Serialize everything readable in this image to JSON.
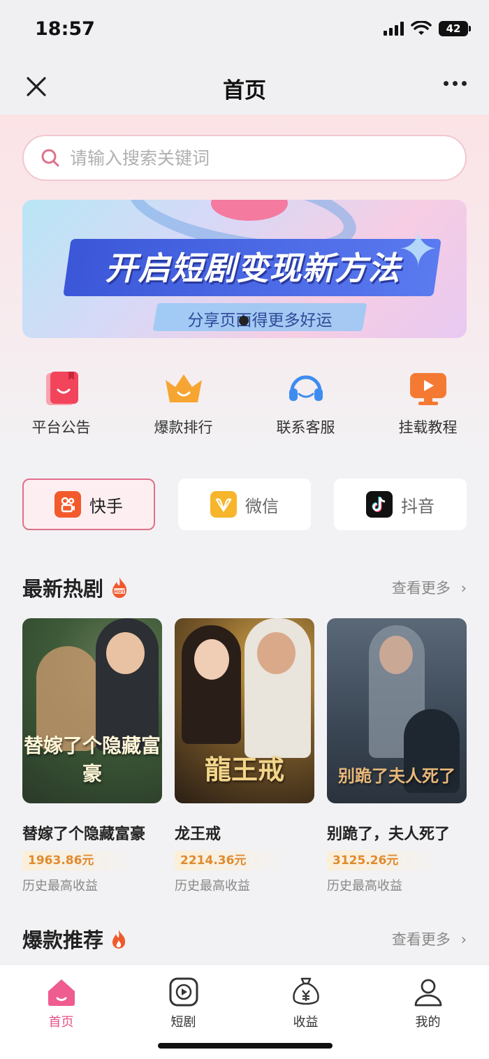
{
  "status": {
    "time": "18:57",
    "battery": "42"
  },
  "nav": {
    "title": "首页"
  },
  "search": {
    "placeholder": "请输入搜索关键词"
  },
  "banner": {
    "title": "开启短剧变现新方法",
    "subtitle": "分享页面得更多好运"
  },
  "quick_menu": [
    {
      "label": "平台公告",
      "icon": "bookmark-icon",
      "color": "#f2455c"
    },
    {
      "label": "爆款排行",
      "icon": "crown-icon",
      "color": "#f7a532"
    },
    {
      "label": "联系客服",
      "icon": "headset-icon",
      "color": "#3f8cf0"
    },
    {
      "label": "挂载教程",
      "icon": "monitor-play-icon",
      "color": "#f47a33"
    }
  ],
  "platforms": [
    {
      "label": "快手",
      "icon": "kuaishou-icon",
      "active": true
    },
    {
      "label": "微信",
      "icon": "wechat-channels-icon",
      "active": false
    },
    {
      "label": "抖音",
      "icon": "douyin-icon",
      "active": false
    }
  ],
  "latest": {
    "title": "最新热剧",
    "more": "查看更多",
    "items": [
      {
        "title": "替嫁了个隐藏富豪",
        "cover_text": "替嫁了个隐藏富豪",
        "income": "1963.86元",
        "caption": "历史最高收益"
      },
      {
        "title": "龙王戒",
        "cover_text": "龍王戒",
        "income": "2214.36元",
        "caption": "历史最高收益"
      },
      {
        "title": "别跪了，夫人死了",
        "cover_text": "别跪了夫人死了",
        "income": "3125.26元",
        "caption": "历史最高收益"
      }
    ]
  },
  "recommend": {
    "title": "爆款推荐",
    "more": "查看更多"
  },
  "tabbar": [
    {
      "label": "首页",
      "icon": "home-icon",
      "active": true
    },
    {
      "label": "短剧",
      "icon": "play-icon",
      "active": false
    },
    {
      "label": "收益",
      "icon": "money-bag-icon",
      "active": false
    },
    {
      "label": "我的",
      "icon": "user-icon",
      "active": false
    }
  ],
  "colors": {
    "accent": "#e84f86",
    "income": "#e08a2e"
  }
}
